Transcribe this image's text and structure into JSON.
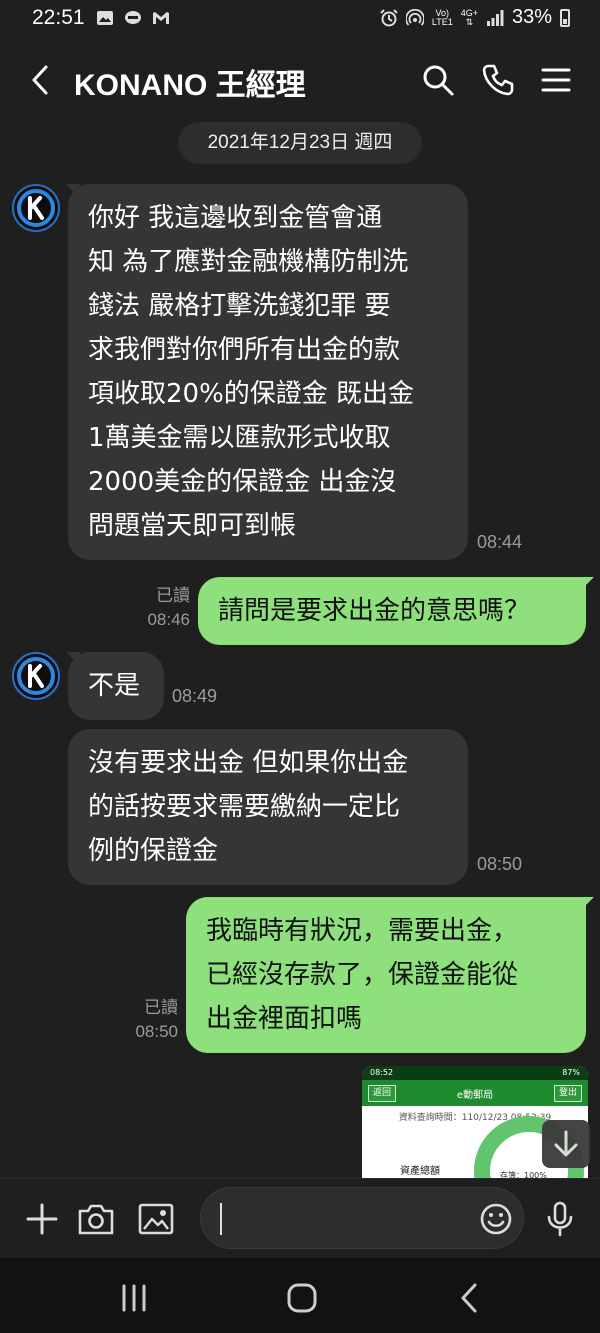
{
  "status_bar": {
    "time": "22:51",
    "network_top": "Vo)",
    "network_bottom": "LTE1",
    "net_type_top": "4G+",
    "battery": "33%",
    "icons": [
      "image-icon",
      "line-icon",
      "gmail-icon",
      "alarm-icon",
      "hotspot-icon",
      "signal-icon",
      "battery-icon"
    ]
  },
  "header": {
    "title": "KONANO 王經理",
    "icons": [
      "back-icon",
      "search-icon",
      "phone-icon",
      "menu-icon"
    ]
  },
  "date_chip": "2021年12月23日 週四",
  "messages": [
    {
      "direction": "in",
      "text": "你好 我這邊收到金管會通\n知 為了應對金融機構防制洗\n錢法 嚴格打擊洗錢犯罪 要\n求我們對你們所有出金的款\n項收取20%的保證金 既出金\n1萬美金需以匯款形式收取\n2000美金的保證金 出金沒\n問題當天即可到帳",
      "time": "08:44"
    },
    {
      "direction": "out",
      "text": "請問是要求出金的意思嗎？",
      "read": "已讀",
      "time": "08:46"
    },
    {
      "direction": "in",
      "text": "不是",
      "time": "08:49"
    },
    {
      "direction": "in",
      "text": "沒有要求出金 但如果你出金\n的話按要求需要繳納一定比\n例的保證金",
      "time": "08:50"
    },
    {
      "direction": "out",
      "text": "我臨時有狀況，需要出金，\n已經沒存款了，保證金能從\n出金裡面扣嗎",
      "read": "已讀",
      "time": "08:50"
    }
  ],
  "image_preview": {
    "status_time": "08:52",
    "status_battery": "87%",
    "back_label": "返回",
    "title": "e動郵局",
    "logout_label": "登出",
    "query_line": "資料查詢時間：110/12/23 08:52:39",
    "assets_label": "資產總額",
    "ring_label": "存簿：100%"
  },
  "input_bar": {
    "placeholder": "",
    "icons": [
      "plus-icon",
      "camera-icon",
      "gallery-icon",
      "emoji-icon",
      "mic-icon"
    ]
  },
  "nav_bar": {
    "icons": [
      "recents-icon",
      "home-icon",
      "nav-back-icon"
    ]
  },
  "colors": {
    "background": "#1f1f1f",
    "incoming_bubble": "#353535",
    "outgoing_bubble": "#8de07c",
    "timestamp": "#9b9b9b"
  }
}
